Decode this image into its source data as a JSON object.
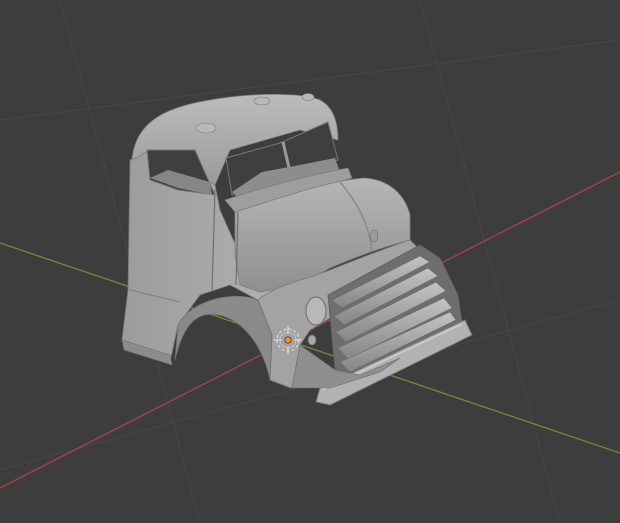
{
  "viewport": {
    "background_color": "#3d3d3d",
    "grid_color": "#474747",
    "x_axis_color": "#a8424d",
    "y_axis_color": "#6e8f2e",
    "model_base_color": "#a9a9a9",
    "model_shadow_color": "#7e7e7e",
    "model_highlight_color": "#bdbdbd",
    "model_dark_color": "#5c5c5c",
    "origin_marker_color": "#ff8a1f",
    "object_origin_icon": "object-origin-icon",
    "model_name": "truck-cab-model"
  }
}
